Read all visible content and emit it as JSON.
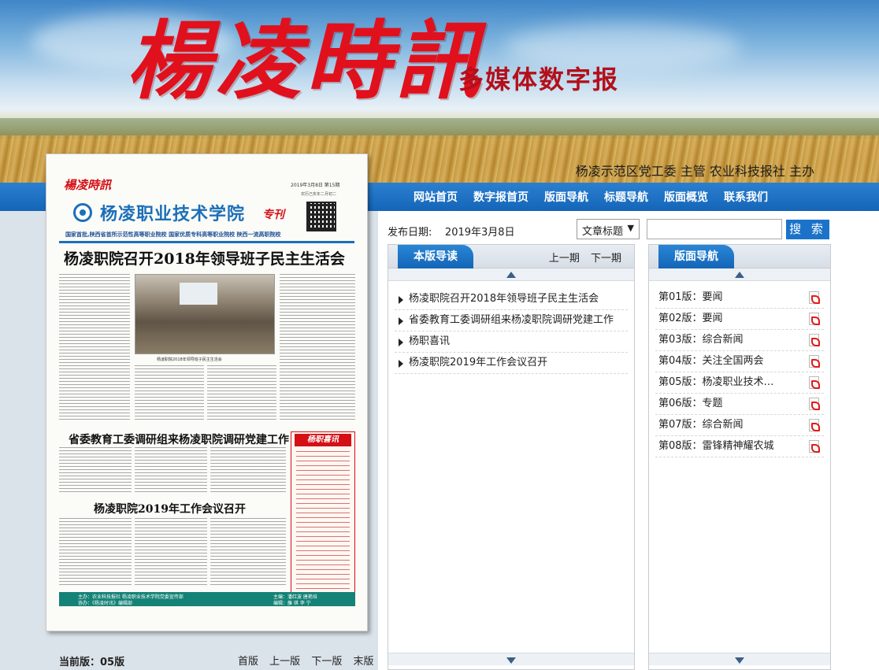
{
  "banner": {
    "logo": "楊凌時訊",
    "subtitle": "多媒体数字报",
    "hosts": "杨凌示范区党工委 主管    农业科技报社 主办"
  },
  "nav": {
    "items": [
      "网站首页",
      "数字报首页",
      "版面导航",
      "标题导航",
      "版面概览",
      "联系我们"
    ]
  },
  "paper": {
    "masthead": "楊凌時訊",
    "date": "2019年3月8日  第15期",
    "date_sub": "农历己亥年二月初二",
    "college": "杨凌职业技术学院",
    "special": "专刊",
    "honors": "国家首批,陕西省首所示范性高等职业院校    国家优质专科高等职业院校    陕西一流高职院校",
    "headline1": "杨凌职院召开2018年领导班子民主生活会",
    "photo_caption": "杨凌职院2018年领导班子民主生活会",
    "headline2": "省委教育工委调研组来杨凌职院调研党建工作",
    "xin_title": "杨职喜讯",
    "headline3": "杨凌职院2019年工作会议召开",
    "footer_l1": "主办：农业科技报社 杨凌职业技术学院党委宣传部",
    "footer_l2": "协办：《杨凌时讯》编辑部",
    "footer_r1": "主编：潘红波 唐艳培",
    "footer_r2": "编辑：雒 琪 李 宁"
  },
  "pager": {
    "current": "当前版：05版",
    "first": "首版",
    "prev": "上一版",
    "next": "下一版",
    "last": "末版"
  },
  "search": {
    "date_label": "发布日期:",
    "date_value": "2019年3月8日",
    "select_value": "文章标题",
    "select_caret": "▼",
    "input_value": "",
    "button": "搜 索"
  },
  "page_guide": {
    "title": "本版导读",
    "prev": "上一期",
    "next": "下一期",
    "articles": [
      "杨凌职院召开2018年领导班子民主生活会",
      "省委教育工委调研组来杨凌职院调研党建工作",
      "杨职喜讯",
      "杨凌职院2019年工作会议召开"
    ]
  },
  "layout_nav": {
    "title": "版面导航",
    "editions": [
      "第01版：要闻",
      "第02版：要闻",
      "第03版：综合新闻",
      "第04版：关注全国两会",
      "第05版：杨凌职业技术…",
      "第06版：专题",
      "第07版：综合新闻",
      "第08版：雷锋精神耀农城"
    ]
  }
}
